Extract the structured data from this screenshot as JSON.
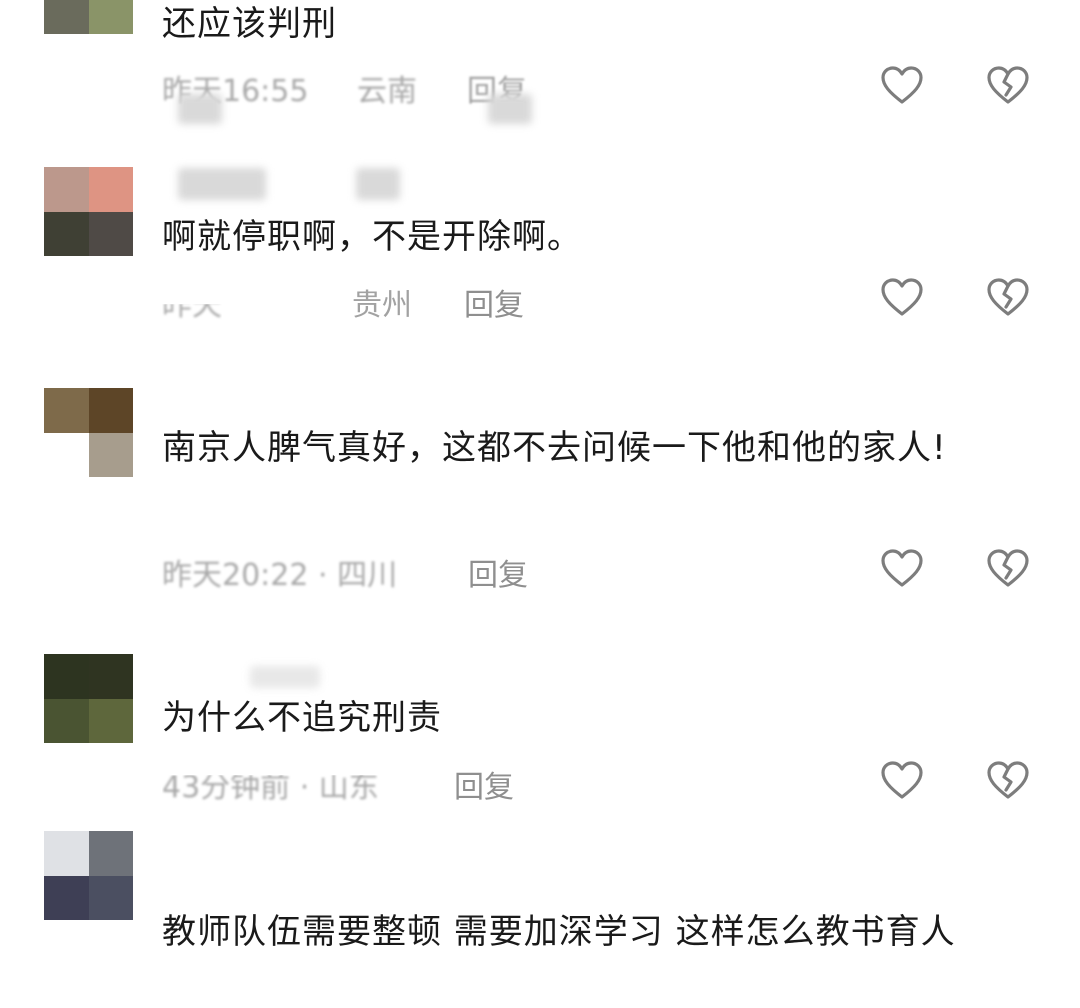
{
  "comments": [
    {
      "text": "还应该判刑",
      "time": "昨天16:55",
      "location": "云南",
      "reply_label": "回复",
      "avatar_colors": [
        "#6a6b5c",
        "#8a9468",
        "#ffffff",
        "#ffffff"
      ]
    },
    {
      "text": "啊就停职啊，不是开除啊。",
      "time": "昨天",
      "location": "贵州",
      "reply_label": "回复",
      "avatar_colors": [
        "#bc988c",
        "#de9483",
        "#3f4034",
        "#4f4a46"
      ]
    },
    {
      "text": "南京人脾气真好，这都不去问候一下他和他的家人!",
      "time": "昨天20:22 · 四川",
      "location": "",
      "reply_label": "回复",
      "avatar_colors": [
        "#7e6a4a",
        "#5d4527",
        "#ffffff",
        "#a79d8d"
      ]
    },
    {
      "text": "为什么不追究刑责",
      "time": "43分钟前 · 山东",
      "location": "",
      "reply_label": "回复",
      "avatar_colors": [
        "#2d3420",
        "#2f3421",
        "#4a5432",
        "#5e673c"
      ]
    },
    {
      "text": "教师队伍需要整顿  需要加深学习  这样怎么教书育人",
      "avatar_colors": [
        "#dfe1e5",
        "#6e7279",
        "#3e3f55",
        "#4b4f61"
      ]
    }
  ],
  "icons": {
    "like": "heart-outline-icon",
    "dislike": "broken-heart-icon"
  }
}
